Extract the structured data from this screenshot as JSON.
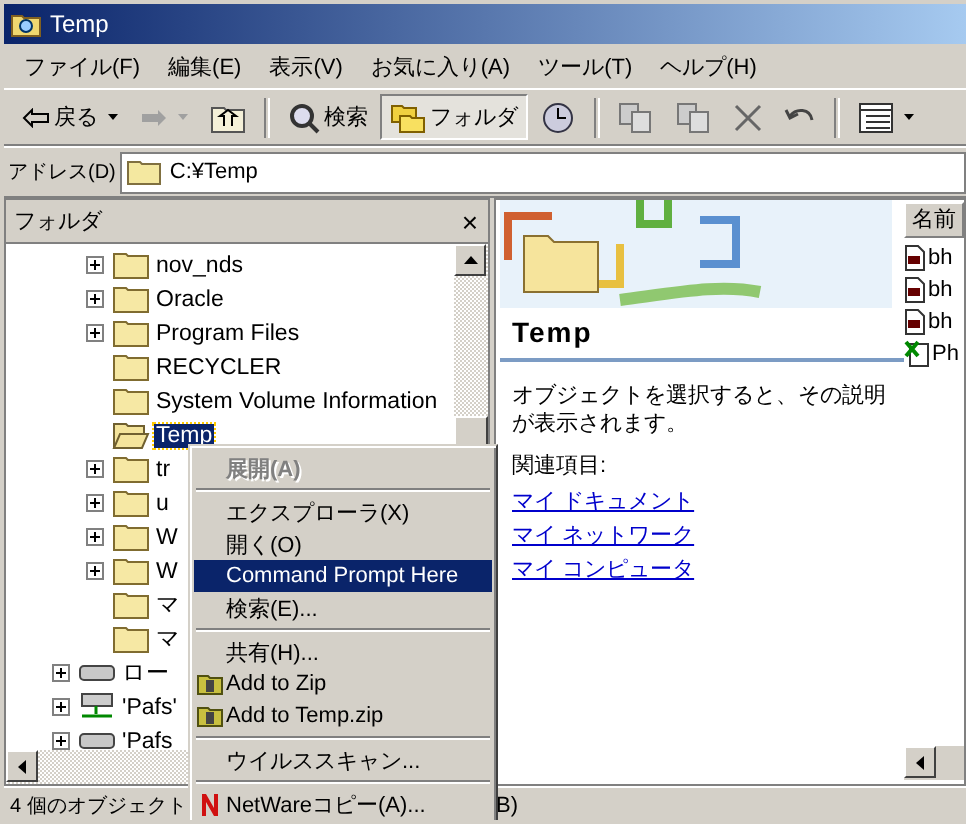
{
  "window": {
    "title": "Temp"
  },
  "menu": [
    "ファイル(F)",
    "編集(E)",
    "表示(V)",
    "お気に入り(A)",
    "ツール(T)",
    "ヘルプ(H)"
  ],
  "toolbar": [
    {
      "kind": "back",
      "label": "戻る"
    },
    {
      "kind": "forward",
      "disabled": true
    },
    {
      "kind": "up"
    },
    {
      "kind": "sep"
    },
    {
      "kind": "search",
      "label": "検索",
      "pressed": false
    },
    {
      "kind": "folders",
      "label": "フォルダ",
      "pressed": true
    },
    {
      "kind": "history"
    },
    {
      "kind": "sep"
    },
    {
      "kind": "move"
    },
    {
      "kind": "copy"
    },
    {
      "kind": "delete"
    },
    {
      "kind": "undo"
    },
    {
      "kind": "sep"
    },
    {
      "kind": "views"
    }
  ],
  "address": {
    "label": "アドレス(D)",
    "value": "C:¥Temp"
  },
  "folder_pane": {
    "title": "フォルダ",
    "close": "×",
    "tree": [
      {
        "children": [
          {
            "label": "nov_nds",
            "kind": "folder",
            "expandable": true,
            "selected": false
          },
          {
            "label": "Oracle",
            "kind": "folder",
            "expandable": true,
            "selected": false
          },
          {
            "label": "Program Files",
            "kind": "folder",
            "expandable": true,
            "selected": false
          },
          {
            "label": "RECYCLER",
            "kind": "folder",
            "expandable": false,
            "selected": false
          },
          {
            "label": "System Volume Information",
            "kind": "folder",
            "expandable": false,
            "selected": false
          },
          {
            "label": "Temp",
            "kind": "open-folder",
            "expandable": false,
            "selected": true
          },
          {
            "label": "tr",
            "kind": "folder",
            "expandable": true,
            "selected": false
          },
          {
            "label": "u",
            "kind": "folder",
            "expandable": true,
            "selected": false
          },
          {
            "label": "W",
            "kind": "folder",
            "expandable": true,
            "selected": false
          },
          {
            "label": "W",
            "kind": "folder",
            "expandable": true,
            "selected": false
          },
          {
            "label": "マ",
            "kind": "folder",
            "expandable": false,
            "selected": false
          },
          {
            "label": "マ",
            "kind": "folder",
            "expandable": false,
            "selected": false
          }
        ]
      },
      {
        "label": "ロー",
        "kind": "drive",
        "expandable": true,
        "selected": false
      },
      {
        "label": "'Pafs'",
        "kind": "network",
        "expandable": true,
        "selected": false
      },
      {
        "label": "'Pafs",
        "kind": "drive",
        "expandable": true,
        "selected": false
      }
    ]
  },
  "context_menu": [
    {
      "kind": "item",
      "label": "展開(A)",
      "disabled": true,
      "default": true,
      "selected": false
    },
    {
      "kind": "separator"
    },
    {
      "kind": "item",
      "label": "エクスプローラ(X)",
      "disabled": false,
      "default": false,
      "selected": false
    },
    {
      "kind": "item",
      "label": "開く(O)",
      "disabled": false,
      "default": false,
      "selected": false
    },
    {
      "kind": "item",
      "label": "Command Prompt Here",
      "disabled": false,
      "default": false,
      "selected": true
    },
    {
      "kind": "item",
      "label": "検索(E)...",
      "disabled": false,
      "default": false,
      "selected": false
    },
    {
      "kind": "separator"
    },
    {
      "kind": "item",
      "label": "共有(H)...",
      "disabled": false,
      "default": false,
      "selected": false
    },
    {
      "kind": "zip-item",
      "label": "Add to Zip",
      "disabled": false,
      "default": false,
      "selected": false
    },
    {
      "kind": "zip-item",
      "label": "Add to Temp.zip",
      "disabled": false,
      "default": false,
      "selected": false
    },
    {
      "kind": "separator"
    },
    {
      "kind": "item",
      "label": "ウイルススキャン...",
      "disabled": false,
      "default": false,
      "selected": false
    },
    {
      "kind": "separator"
    },
    {
      "kind": "netware-item",
      "label": "NetWareコピー(A)...",
      "disabled": false,
      "default": false,
      "selected": false
    }
  ],
  "details": {
    "title": "Temp",
    "description": "オブジェクトを選択すると、その説明が表示されます。",
    "related_label": "関連項目:",
    "links": [
      "マイ ドキュメント",
      "マイ ネットワーク",
      "マイ コンピュータ"
    ]
  },
  "file_list": {
    "column": "名前",
    "items": [
      {
        "name": "bh",
        "kind": "document"
      },
      {
        "name": "bh",
        "kind": "document"
      },
      {
        "name": "bh",
        "kind": "document"
      },
      {
        "name": "Ph",
        "kind": "spreadsheet"
      }
    ]
  },
  "status_bar": [
    "4 個のオブジェクト",
    "B)"
  ]
}
